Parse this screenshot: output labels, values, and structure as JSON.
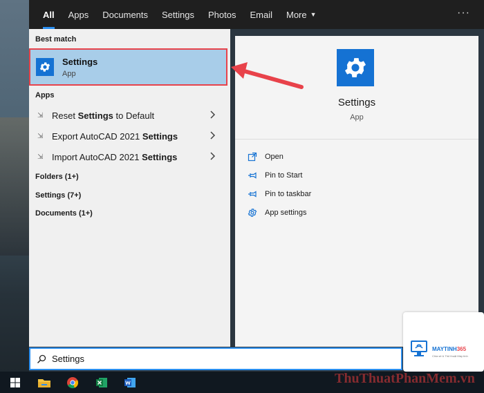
{
  "tabs": [
    {
      "label": "All",
      "active": true
    },
    {
      "label": "Apps"
    },
    {
      "label": "Documents"
    },
    {
      "label": "Settings"
    },
    {
      "label": "Photos"
    },
    {
      "label": "Email"
    },
    {
      "label": "More"
    }
  ],
  "more_menu_label": "···",
  "best_match": {
    "section_label": "Best match",
    "title": "Settings",
    "subtitle": "App",
    "icon": "gear-icon"
  },
  "apps_section": {
    "label": "Apps",
    "items": [
      {
        "prefix": "Reset ",
        "bold": "Settings",
        "suffix": " to Default"
      },
      {
        "prefix": "Export AutoCAD 2021 ",
        "bold": "Settings",
        "suffix": ""
      },
      {
        "prefix": "Import AutoCAD 2021 ",
        "bold": "Settings",
        "suffix": ""
      }
    ]
  },
  "categories": [
    {
      "label": "Folders (1+)"
    },
    {
      "label": "Settings (7+)"
    },
    {
      "label": "Documents (1+)"
    }
  ],
  "preview": {
    "title": "Settings",
    "subtitle": "App",
    "actions": [
      {
        "label": "Open",
        "icon": "open-icon"
      },
      {
        "label": "Pin to Start",
        "icon": "pin-icon"
      },
      {
        "label": "Pin to taskbar",
        "icon": "pin-icon"
      },
      {
        "label": "App settings",
        "icon": "gear-icon"
      }
    ]
  },
  "search": {
    "value": "Settings"
  },
  "taskbar": {
    "items": [
      "windows-icon",
      "file-explorer-icon",
      "chrome-icon",
      "excel-icon",
      "word-icon"
    ]
  },
  "watermark": {
    "logo_brand": "MAYTINH",
    "logo_brand_number": "365",
    "logo_tagline": "Chia sẻ & Thủ thuật Máy tính",
    "text": "ThuThuatPhanMem.vn"
  },
  "colors": {
    "accent": "#2b8ff0",
    "app_icon_blue": "#1572d3",
    "highlight_bg": "#a8cde9",
    "highlight_border": "#e8424a",
    "annotation_arrow": "#e8424a"
  }
}
